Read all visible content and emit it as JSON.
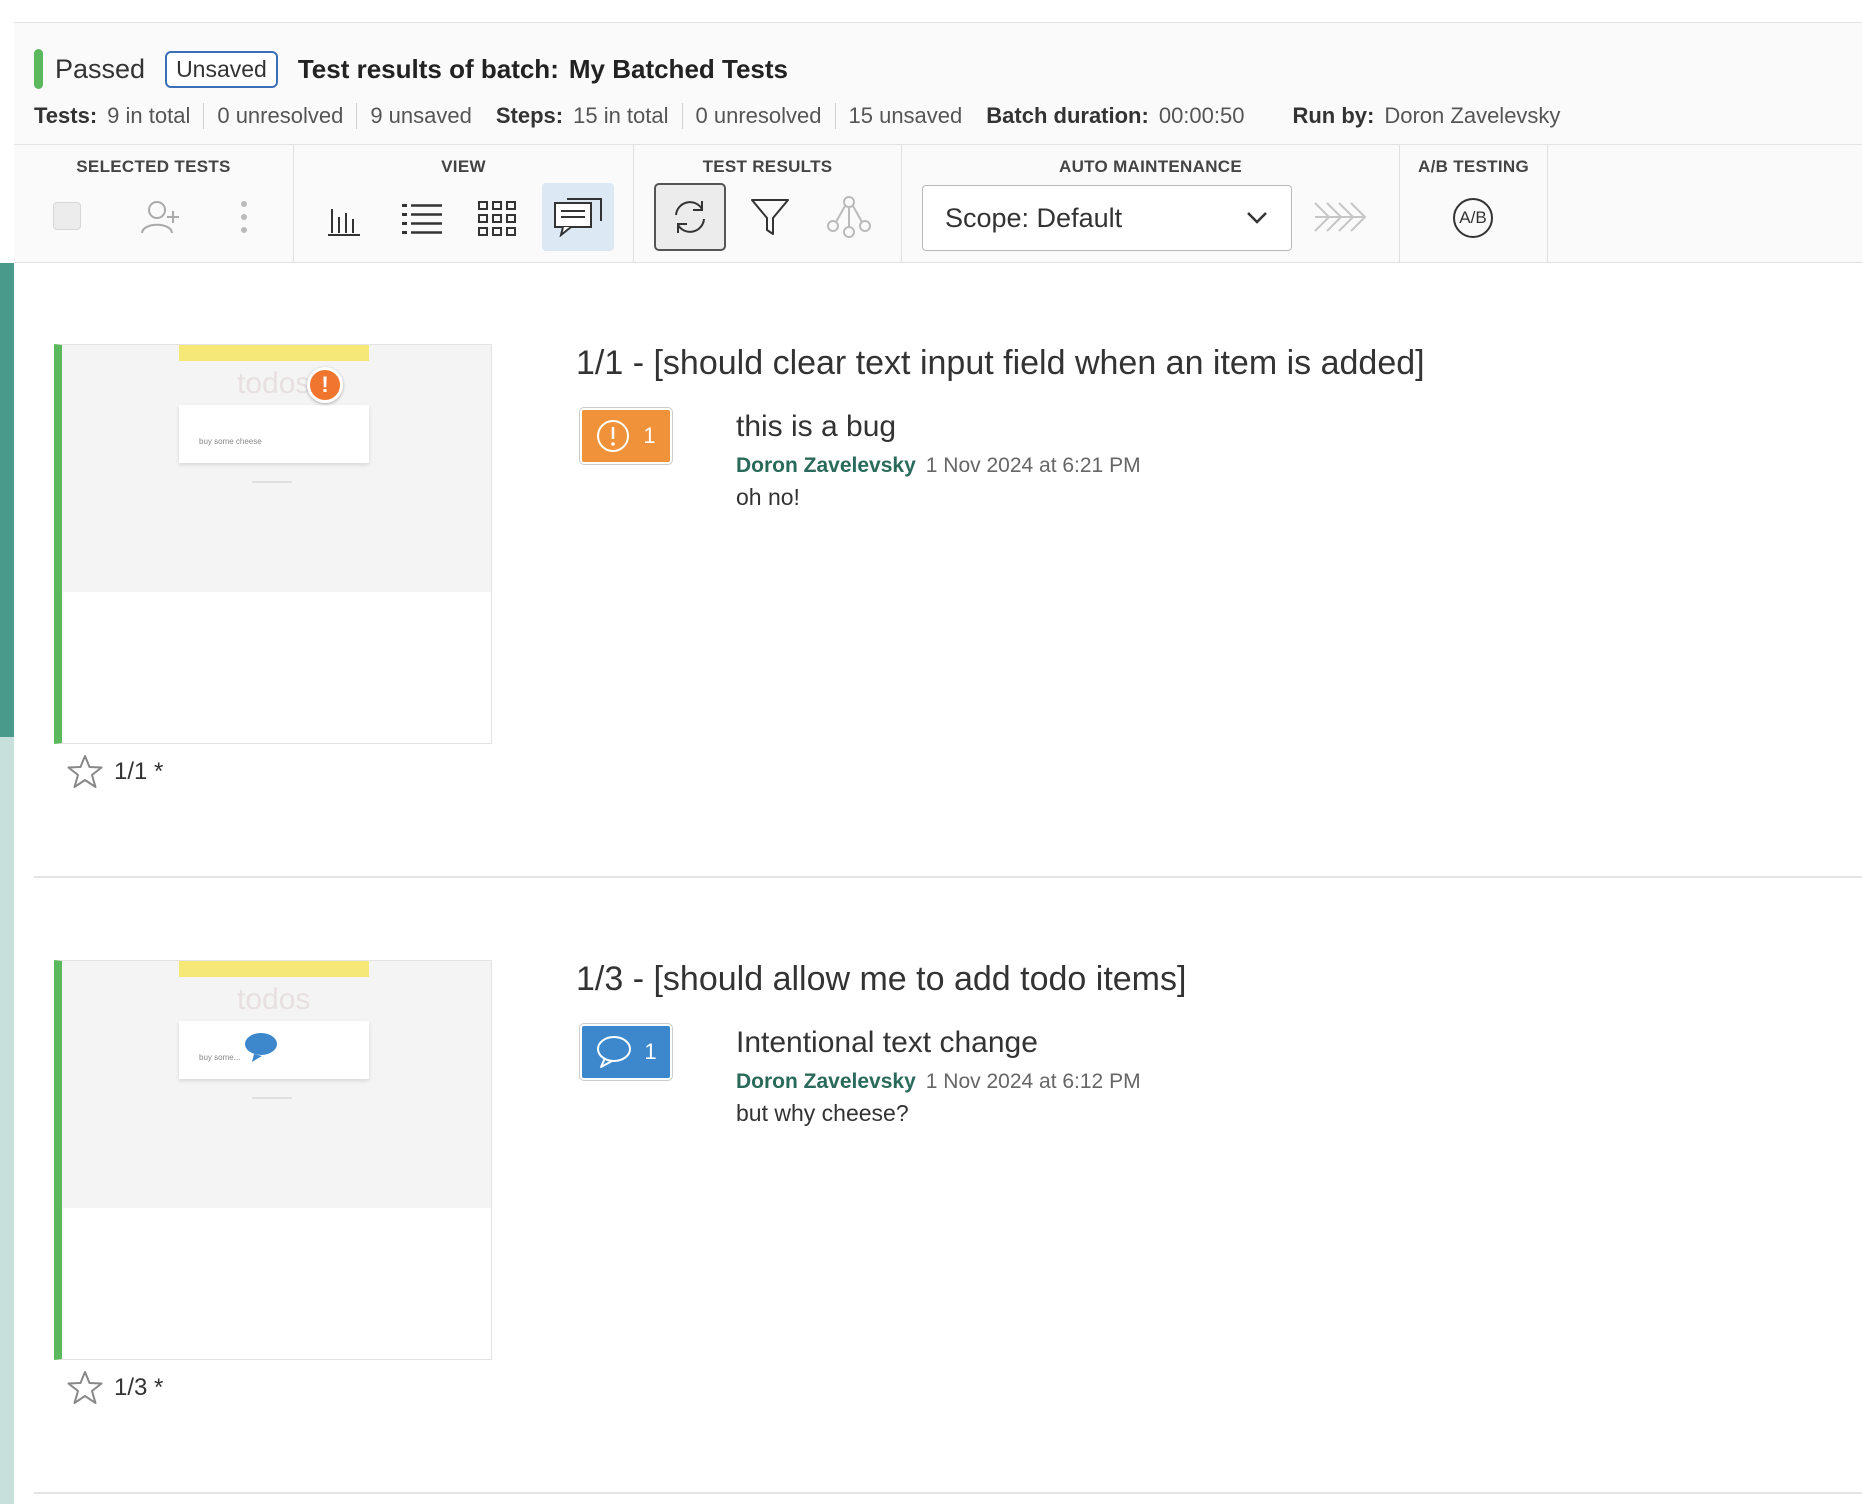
{
  "header": {
    "status": "Passed",
    "unsaved_badge": "Unsaved",
    "title_prefix": "Test results of batch:",
    "batch_name": "My Batched Tests",
    "colors": {
      "passed": "#5cb85c",
      "unsaved_border": "#3a6fb8"
    }
  },
  "stats": {
    "tests_label": "Tests:",
    "tests_total": "9 in total",
    "tests_unresolved": "0 unresolved",
    "tests_unsaved": "9 unsaved",
    "steps_label": "Steps:",
    "steps_total": "15 in total",
    "steps_unresolved": "0 unresolved",
    "steps_unsaved": "15 unsaved",
    "duration_label": "Batch duration:",
    "duration_value": "00:00:50",
    "runby_label": "Run by:",
    "runby_value": "Doron Zavelevsky"
  },
  "toolbar": {
    "selected_tests_label": "SELECTED TESTS",
    "view_label": "VIEW",
    "test_results_label": "TEST RESULTS",
    "auto_maintenance_label": "AUTO MAINTENANCE",
    "scope_select_value": "Scope: Default",
    "ab_testing_label": "A/B TESTING",
    "ab_icon_text": "A/B",
    "icons": [
      "checkbox-icon",
      "assign-user-icon",
      "more-vertical-icon",
      "bar-chart-icon",
      "list-view-icon",
      "grid-view-icon",
      "comments-view-icon",
      "refresh-icon",
      "filter-icon",
      "branch-icon",
      "chevron-down-icon",
      "maintenance-arrows-icon",
      "ab-testing-icon"
    ]
  },
  "cards": [
    {
      "title": "1/1 - [should clear text input field when an item is added]",
      "step_label": "1/1 *",
      "badge_type": "issue",
      "badge_count": "1",
      "badge_color": "#f0923a",
      "note_title": "this is a bug",
      "author": "Doron Zavelevsky",
      "date": "1 Nov 2024 at 6:21 PM",
      "body": "oh no!",
      "thumb_word": "todos",
      "thumb_item": "buy some cheese"
    },
    {
      "title": "1/3 - [should allow me to add todo items]",
      "step_label": "1/3 *",
      "badge_type": "remark",
      "badge_count": "1",
      "badge_color": "#3d88cc",
      "note_title": "Intentional text change",
      "author": "Doron Zavelevsky",
      "date": "1 Nov 2024 at 6:12 PM",
      "body": "but why cheese?",
      "thumb_word": "todos",
      "thumb_item": "buy some..."
    }
  ]
}
